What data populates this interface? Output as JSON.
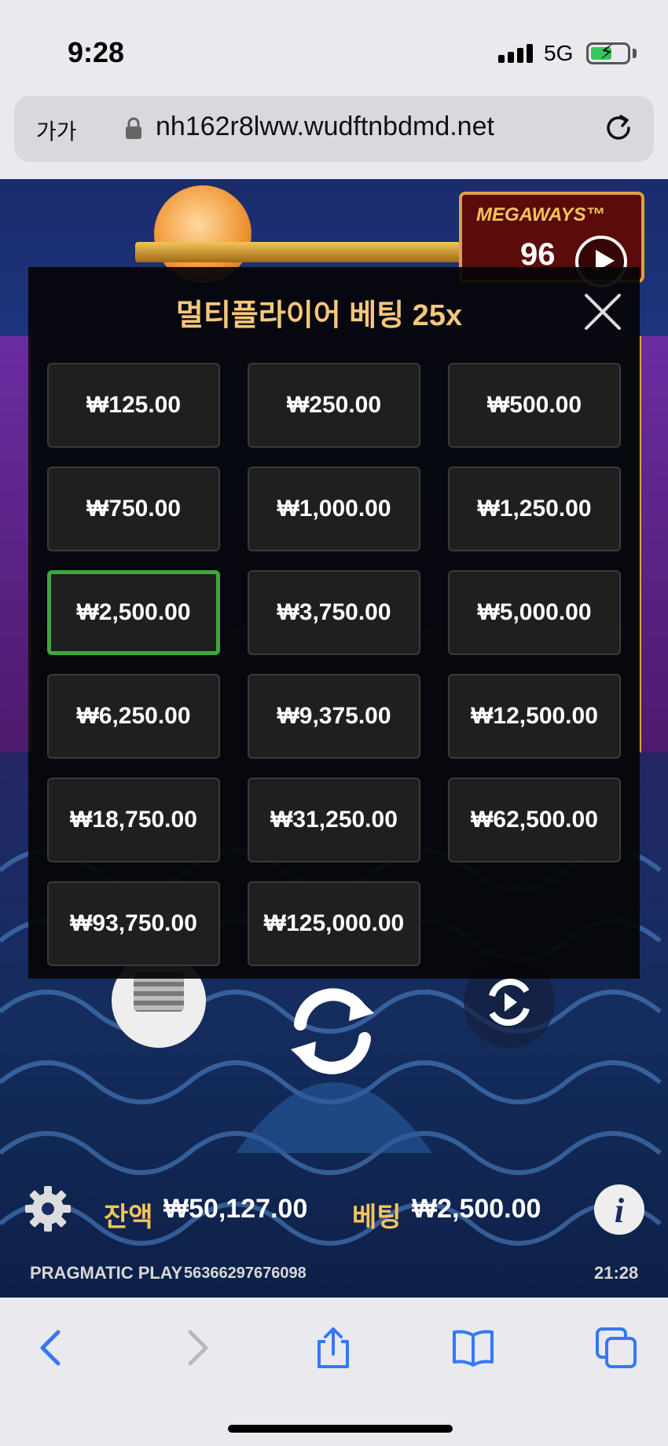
{
  "status_bar": {
    "time": "9:28",
    "network": "5G"
  },
  "browser": {
    "text_size_label": "가가",
    "url": "nh162r8lww.wudftnbdmd.net"
  },
  "game": {
    "logo_text": "MEGAWAYS™",
    "logo_number": "96",
    "balance_label": "잔액",
    "balance_value": "₩50,127.00",
    "bet_label": "베팅",
    "bet_value": "₩2,500.00",
    "provider": "PRAGMATIC PLAY",
    "session_id": "56366297676098",
    "clock": "21:28"
  },
  "bet_modal": {
    "title": "멀티플라이어 베팅 25x",
    "selected_index": 6,
    "options": [
      "₩125.00",
      "₩250.00",
      "₩500.00",
      "₩750.00",
      "₩1,000.00",
      "₩1,250.00",
      "₩2,500.00",
      "₩3,750.00",
      "₩5,000.00",
      "₩6,250.00",
      "₩9,375.00",
      "₩12,500.00",
      "₩18,750.00",
      "₩31,250.00",
      "₩62,500.00",
      "₩93,750.00",
      "₩125,000.00"
    ]
  },
  "colors": {
    "accent_gold": "#f5c77a",
    "selected_border": "#3ea83a",
    "ios_blue": "#3478f6"
  },
  "icons": {
    "close": "close-icon",
    "settings": "gear-icon",
    "info": "info-icon",
    "spin": "spin-icon",
    "back": "chevron-left-icon",
    "forward": "chevron-right-icon",
    "share": "share-icon",
    "bookmarks": "book-icon",
    "tabs": "tabs-icon"
  }
}
